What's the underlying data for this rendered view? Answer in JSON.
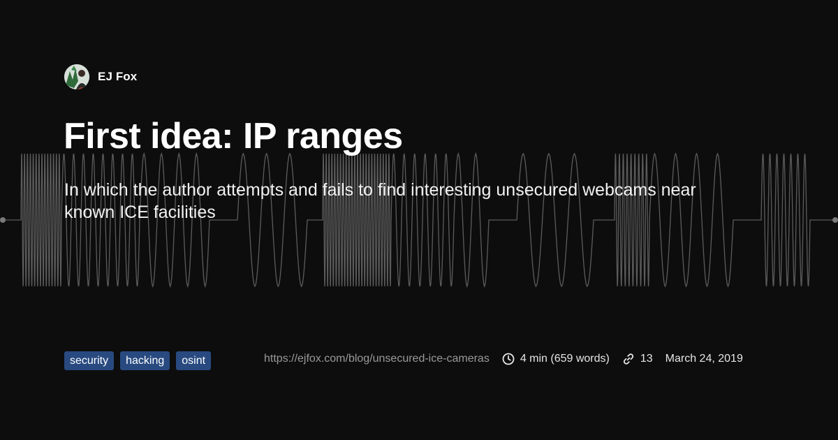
{
  "author": {
    "name": "EJ Fox",
    "avatar_icon": "avatar-photo"
  },
  "post": {
    "title": "First idea: IP ranges",
    "subtitle": "In which the author attempts and fails to find interesting unsecured webcams near known ICE facilities",
    "tags": [
      "security",
      "hacking",
      "osint"
    ],
    "url": "https://ejfox.com/blog/unsecured-ice-cameras",
    "reading_time": "4 min (659 words)",
    "link_count": "13",
    "date": "March 24, 2019"
  },
  "icons": {
    "clock": "clock-icon",
    "link": "link-icon"
  },
  "colors": {
    "background": "#0d0d0d",
    "tag_bg": "#284a80",
    "wave": "#5c5c5c"
  }
}
